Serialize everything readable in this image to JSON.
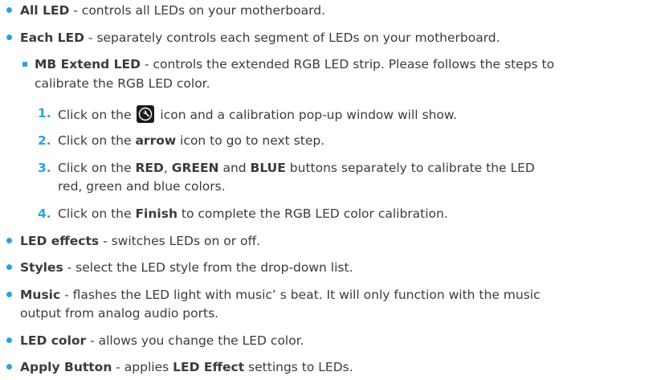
{
  "items": [
    {
      "title": "All LED",
      "desc": " - controls all LEDs on your motherboard."
    },
    {
      "title": "Each LED",
      "desc": " - separately controls each segment of LEDs on your motherboard."
    }
  ],
  "sub_item": {
    "title": "MB Extend LED",
    "desc_line1": " - controls the extended RGB LED strip. Please follows the steps to",
    "desc_line2": "calibrate the RGB LED color."
  },
  "steps": [
    {
      "num": "1.",
      "pre": "Click on the ",
      "post": " icon and a calibration pop-up window will show."
    },
    {
      "num": "2.",
      "pre": "Click on the ",
      "bold": "arrow",
      "post": " icon to go to next step."
    },
    {
      "num": "3.",
      "pre": "Click on the ",
      "bold1": "RED",
      "sep1": ", ",
      "bold2": "GREEN",
      "sep2": " and ",
      "bold3": "BLUE",
      "post": " buttons separately to calibrate the LED",
      "line2": "red, green and blue colors."
    },
    {
      "num": "4.",
      "pre": "Click on the ",
      "bold": "Finish",
      "post": " to complete the RGB LED color calibration."
    }
  ],
  "more_items": [
    {
      "title": "LED effects",
      "desc": " - switches LEDs on or off."
    },
    {
      "title": "Styles",
      "desc": " - select the LED style from the drop-down list."
    },
    {
      "title": "Music",
      "desc": " - flashes the LED light with music’ s beat. It will only function with the music",
      "desc2": "output from analog audio ports."
    },
    {
      "title": "LED color",
      "desc": " - allows you change the LED color."
    },
    {
      "title": "Apply Button",
      "desc": " - applies ",
      "bold": "LED Effect",
      "desc_end": " settings to LEDs."
    }
  ],
  "icons": {
    "calibrate": "wrench-icon"
  },
  "colors": {
    "accent": "#2aa3e0",
    "text": "#3b3b3b"
  }
}
